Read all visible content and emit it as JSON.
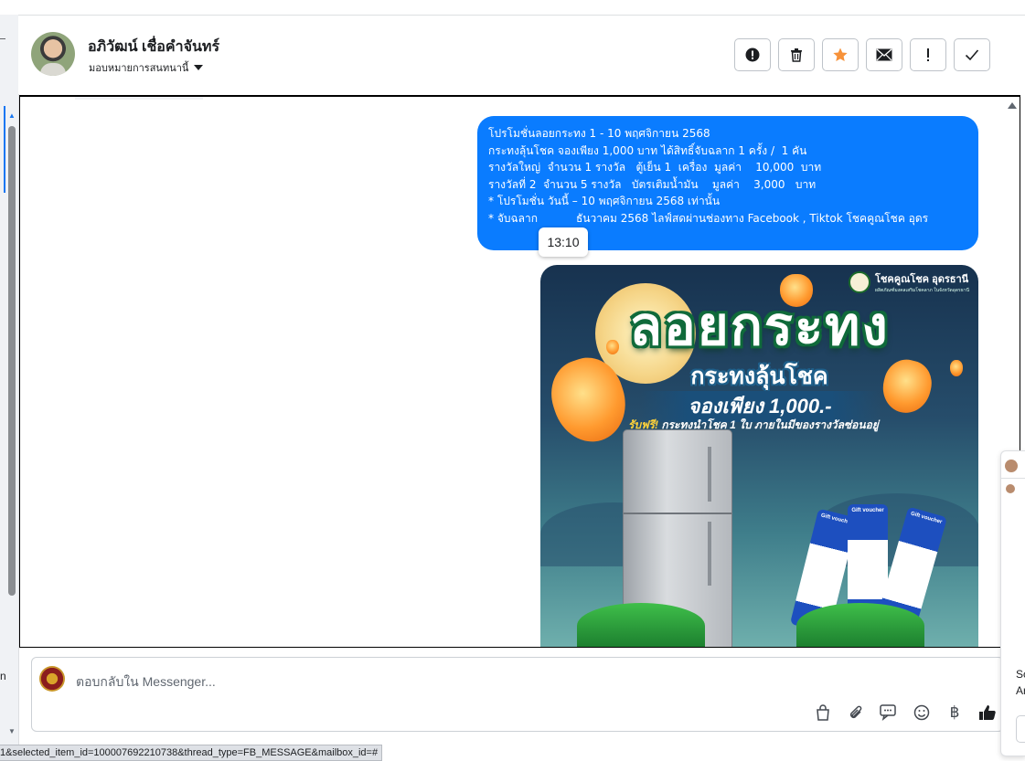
{
  "contact": {
    "name": "อภิวัฒน์ เชื่อคำจันทร์",
    "assign_label": "มอบหมายการสนทนานี้"
  },
  "toolbar": {
    "buttons": [
      "alert-icon",
      "trash-icon",
      "star-icon",
      "envelope-icon",
      "exclamation-icon",
      "check-icon"
    ],
    "star_color": "#f7923a"
  },
  "message": {
    "lines": [
      "โปรโมชั่นลอยกระทง 1 - 10 พฤศจิกายน 2568",
      "กระทงลุ้นโชค จองเพียง 1,000 บาท ได้สิทธิ์จับฉลาก 1 ครั้ง /  1 คัน",
      "รางวัลใหญ่  จำนวน 1 รางวัล   ตู้เย็น 1  เครื่อง  มูลค่า    10,000  บาท",
      "รางวัลที่ 2  จำนวน 5 รางวัล   บัตรเติมน้ำมัน    มูลค่า    3,000   บาท",
      "",
      "* โปรโมชั่น วันนี้ – 10 พฤศจิกายน 2568 เท่านั้น",
      "* จับฉลาก           ธันวาคม 2568 ไลฟ์สดผ่านช่องทาง Facebook , Tiktok โชคคูณโชค อุดร"
    ],
    "time_tooltip": "13:10",
    "bubble_color": "#0a7cff"
  },
  "promo_image": {
    "brand": "โชคคูณโชค อุดรธานี",
    "brand_tagline": "ผลิตภัณฑ์มงคลเสริมโชคลาภ ในจังหวัดอุดรธานี",
    "headline": "ลอยกระทง",
    "subheadline": "กระทงลุ้นโชค",
    "price": "จองเพียง 1,000.-",
    "free_highlight": "รับฟรี!",
    "free_text": " กระทงนำโชค 1 ใบ ภายในมีของรางวัลซ่อนอยู่",
    "voucher_label": "Gift voucher"
  },
  "composer": {
    "placeholder": "ตอบกลับใน Messenger...",
    "tools": [
      "shopping-bag-icon",
      "paperclip-icon",
      "chat-bubbles-icon",
      "smiley-icon",
      "baht-icon",
      "thumbs-up-icon"
    ],
    "baht_glyph": "฿"
  },
  "side_panel": {
    "line1": "Sc",
    "line2": "Ar"
  },
  "left_edge_letter": "n",
  "status_url": "1&selected_item_id=100007692210738&thread_type=FB_MESSAGE&mailbox_id=#"
}
